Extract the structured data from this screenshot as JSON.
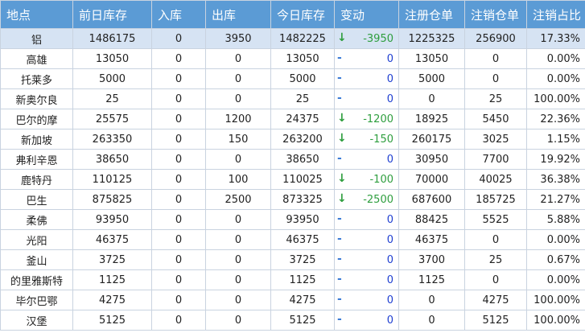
{
  "columns": [
    "地点",
    "前日库存",
    "入库",
    "出库",
    "今日库存",
    "变动",
    "注册仓单",
    "注销仓单",
    "注销占比"
  ],
  "colors": {
    "header_bg": "#5b9bd5",
    "header_text": "#ffffff",
    "highlight_row": "#d6e3f3",
    "decrease_green": "#2e9e3e",
    "zero_blue": "#1f3fd1",
    "grid_line": "#c9d3e0"
  },
  "rows": [
    {
      "location": "铝",
      "prev": "1486175",
      "in": "0",
      "out": "3950",
      "today": "1482225",
      "trend": "↓",
      "trend_icon": "down-arrow-icon",
      "change": "-3950",
      "reg": "1225325",
      "cancel": "256900",
      "ratio": "17.33%"
    },
    {
      "location": "高雄",
      "prev": "13050",
      "in": "0",
      "out": "0",
      "today": "13050",
      "trend": "-",
      "trend_icon": "dash-icon",
      "change": "0",
      "reg": "13050",
      "cancel": "0",
      "ratio": "0.00%"
    },
    {
      "location": "托莱多",
      "prev": "5000",
      "in": "0",
      "out": "0",
      "today": "5000",
      "trend": "-",
      "trend_icon": "dash-icon",
      "change": "0",
      "reg": "5000",
      "cancel": "0",
      "ratio": "0.00%"
    },
    {
      "location": "新奥尔良",
      "prev": "25",
      "in": "0",
      "out": "0",
      "today": "25",
      "trend": "-",
      "trend_icon": "dash-icon",
      "change": "0",
      "reg": "0",
      "cancel": "25",
      "ratio": "100.00%"
    },
    {
      "location": "巴尔的摩",
      "prev": "25575",
      "in": "0",
      "out": "1200",
      "today": "24375",
      "trend": "↓",
      "trend_icon": "down-arrow-icon",
      "change": "-1200",
      "reg": "18925",
      "cancel": "5450",
      "ratio": "22.36%"
    },
    {
      "location": "新加坡",
      "prev": "263350",
      "in": "0",
      "out": "150",
      "today": "263200",
      "trend": "↓",
      "trend_icon": "down-arrow-icon",
      "change": "-150",
      "reg": "260175",
      "cancel": "3025",
      "ratio": "1.15%"
    },
    {
      "location": "弗利辛恩",
      "prev": "38650",
      "in": "0",
      "out": "0",
      "today": "38650",
      "trend": "-",
      "trend_icon": "dash-icon",
      "change": "0",
      "reg": "30950",
      "cancel": "7700",
      "ratio": "19.92%"
    },
    {
      "location": "鹿特丹",
      "prev": "110125",
      "in": "0",
      "out": "100",
      "today": "110025",
      "trend": "↓",
      "trend_icon": "down-arrow-icon",
      "change": "-100",
      "reg": "70000",
      "cancel": "40025",
      "ratio": "36.38%"
    },
    {
      "location": "巴生",
      "prev": "875825",
      "in": "0",
      "out": "2500",
      "today": "873325",
      "trend": "↓",
      "trend_icon": "down-arrow-icon",
      "change": "-2500",
      "reg": "687600",
      "cancel": "185725",
      "ratio": "21.27%"
    },
    {
      "location": "柔佛",
      "prev": "93950",
      "in": "0",
      "out": "0",
      "today": "93950",
      "trend": "-",
      "trend_icon": "dash-icon",
      "change": "0",
      "reg": "88425",
      "cancel": "5525",
      "ratio": "5.88%"
    },
    {
      "location": "光阳",
      "prev": "46375",
      "in": "0",
      "out": "0",
      "today": "46375",
      "trend": "-",
      "trend_icon": "dash-icon",
      "change": "0",
      "reg": "46375",
      "cancel": "0",
      "ratio": "0.00%"
    },
    {
      "location": "釜山",
      "prev": "3725",
      "in": "0",
      "out": "0",
      "today": "3725",
      "trend": "-",
      "trend_icon": "dash-icon",
      "change": "0",
      "reg": "3700",
      "cancel": "25",
      "ratio": "0.67%"
    },
    {
      "location": "的里雅斯特",
      "prev": "1125",
      "in": "0",
      "out": "0",
      "today": "1125",
      "trend": "-",
      "trend_icon": "dash-icon",
      "change": "0",
      "reg": "1125",
      "cancel": "0",
      "ratio": "0.00%"
    },
    {
      "location": "毕尔巴鄂",
      "prev": "4275",
      "in": "0",
      "out": "0",
      "today": "4275",
      "trend": "-",
      "trend_icon": "dash-icon",
      "change": "0",
      "reg": "0",
      "cancel": "4275",
      "ratio": "100.00%"
    },
    {
      "location": "汉堡",
      "prev": "5125",
      "in": "0",
      "out": "0",
      "today": "5125",
      "trend": "-",
      "trend_icon": "dash-icon",
      "change": "0",
      "reg": "0",
      "cancel": "5125",
      "ratio": "100.00%"
    }
  ]
}
